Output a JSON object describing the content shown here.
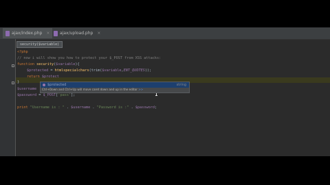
{
  "tabs": [
    {
      "label": "ajax/index.php",
      "close": "×",
      "active": true
    },
    {
      "label": "ajax/upload.php",
      "close": "×",
      "active": false
    }
  ],
  "breadcrumb": "security($variable)",
  "code": {
    "l1": "<?php",
    "l2": "// now i will show you how to protect your $_POST from XSS attacks:",
    "l3_kw": "function ",
    "l3_fn": "security",
    "l3_rest_a": "(",
    "l3_var": "$variable",
    "l3_rest_b": "){",
    "l4_var": "$protected",
    "l4_a": " = ",
    "l4_fn": "htmlspecialchars",
    "l4_b": "(trim(",
    "l4_var2": "$variable",
    "l4_c": ",",
    "l4_const": "ENT_QUOTES",
    "l4_d": "));",
    "l5_kw": "return ",
    "l5_var": "$protect",
    "l6_a": "}",
    "l7_var": "$username",
    "l8_var": "$password",
    "l8_a": " = ",
    "l8_var2": "$_POST",
    "l8_b": "[",
    "l8_str": "'pass'",
    "l8_c": "];",
    "l10_kw": "print ",
    "l10_s1": "\"Username is : \"",
    "l10_a": " . ",
    "l10_v1": "$username",
    "l10_b": " . ",
    "l10_s2": "\"Password is :\"",
    "l10_c": " . ",
    "l10_v2": "$password",
    "l10_d": ";"
  },
  "autocomplete": {
    "item": "$protected",
    "type": "string",
    "hint_a": "Ctrl+Down and Ctrl+Up will move caret down and up in the editor ",
    "hint_link": ">>"
  }
}
